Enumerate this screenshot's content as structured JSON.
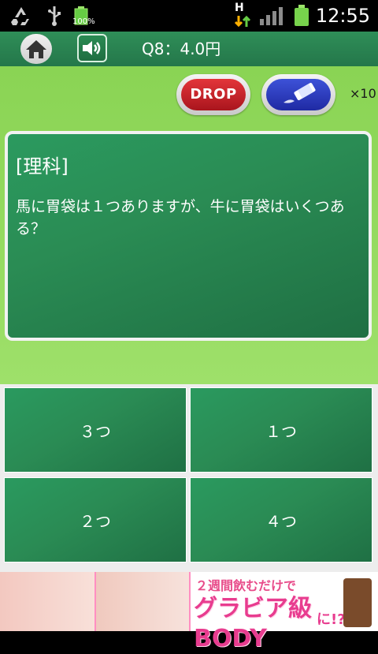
{
  "status_bar": {
    "battery_small_text": "100%",
    "network_label": "H",
    "time": "12:55"
  },
  "header": {
    "question_info": "Q8：4.0円",
    "icons": [
      "home-icon",
      "speaker-icon"
    ]
  },
  "tools": {
    "drop_label": "DROP",
    "eraser_icon": "eraser-icon",
    "multiplier": "×10"
  },
  "question": {
    "subject": "[理科]",
    "text": "馬に胃袋は１つありますが、牛に胃袋はいくつある？"
  },
  "answers": [
    {
      "label": "３つ"
    },
    {
      "label": "１つ"
    },
    {
      "label": "２つ"
    },
    {
      "label": "４つ"
    }
  ],
  "ad": {
    "line1": "２週間飲むだけで",
    "line2": "グラビア級BODY",
    "line3": "に!?"
  },
  "colors": {
    "panel_green": "#9ee06a",
    "board_green": "#2a8c54",
    "drop_red": "#c8212a",
    "eraser_blue": "#2f3fbf"
  }
}
